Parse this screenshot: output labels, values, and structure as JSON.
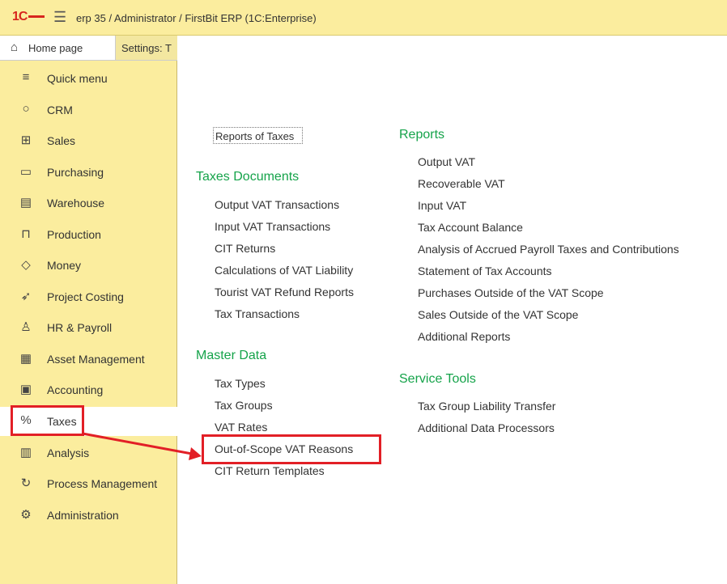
{
  "window": {
    "logo_text": "1С",
    "title": "erp 35 / Administrator / FirstBit ERP  (1C:Enterprise)"
  },
  "tabs": {
    "home_label": "Home page",
    "settings_label": "Settings: T"
  },
  "sidebar": {
    "items": [
      {
        "label": "Quick menu",
        "icon": "hamburger-icon"
      },
      {
        "label": "CRM",
        "icon": "chat-icon"
      },
      {
        "label": "Sales",
        "icon": "basket-icon"
      },
      {
        "label": "Purchasing",
        "icon": "truck-icon"
      },
      {
        "label": "Warehouse",
        "icon": "warehouse-icon"
      },
      {
        "label": "Production",
        "icon": "factory-icon"
      },
      {
        "label": "Money",
        "icon": "coin-icon"
      },
      {
        "label": "Project Costing",
        "icon": "rocket-icon"
      },
      {
        "label": "HR & Payroll",
        "icon": "person-icon"
      },
      {
        "label": "Asset Management",
        "icon": "assets-icon"
      },
      {
        "label": "Accounting",
        "icon": "calculator-icon"
      },
      {
        "label": "Taxes",
        "icon": "percent-icon"
      },
      {
        "label": "Analysis",
        "icon": "bar-chart-icon"
      },
      {
        "label": "Process Management",
        "icon": "process-icon"
      },
      {
        "label": "Administration",
        "icon": "gear-icon"
      }
    ],
    "active_item": "Taxes"
  },
  "content": {
    "reports_of_taxes": "Reports of Taxes",
    "taxes_documents": {
      "heading": "Taxes Documents",
      "items": [
        "Output VAT Transactions",
        "Input VAT Transactions",
        "CIT Returns",
        "Calculations of VAT Liability",
        "Tourist VAT Refund Reports",
        "Tax Transactions"
      ]
    },
    "master_data": {
      "heading": "Master Data",
      "items": [
        "Tax Types",
        "Tax Groups",
        "VAT Rates",
        "Out-of-Scope VAT Reasons",
        "CIT Return Templates"
      ]
    },
    "reports": {
      "heading": "Reports",
      "items": [
        "Output VAT",
        "Recoverable VAT",
        "Input VAT",
        "Tax Account Balance",
        "Analysis of Accrued Payroll Taxes and Contributions",
        "Statement of Tax Accounts",
        "Purchases Outside of the VAT Scope",
        "Sales Outside of the VAT Scope",
        "Additional Reports"
      ]
    },
    "service_tools": {
      "heading": "Service Tools",
      "items": [
        "Tax Group Liability Transfer",
        "Additional Data Processors"
      ]
    }
  },
  "colors": {
    "header_bg": "#fbed9e",
    "heading_green": "#15a34a",
    "highlight_red": "#e21f26",
    "logo_red": "#d7261e"
  }
}
